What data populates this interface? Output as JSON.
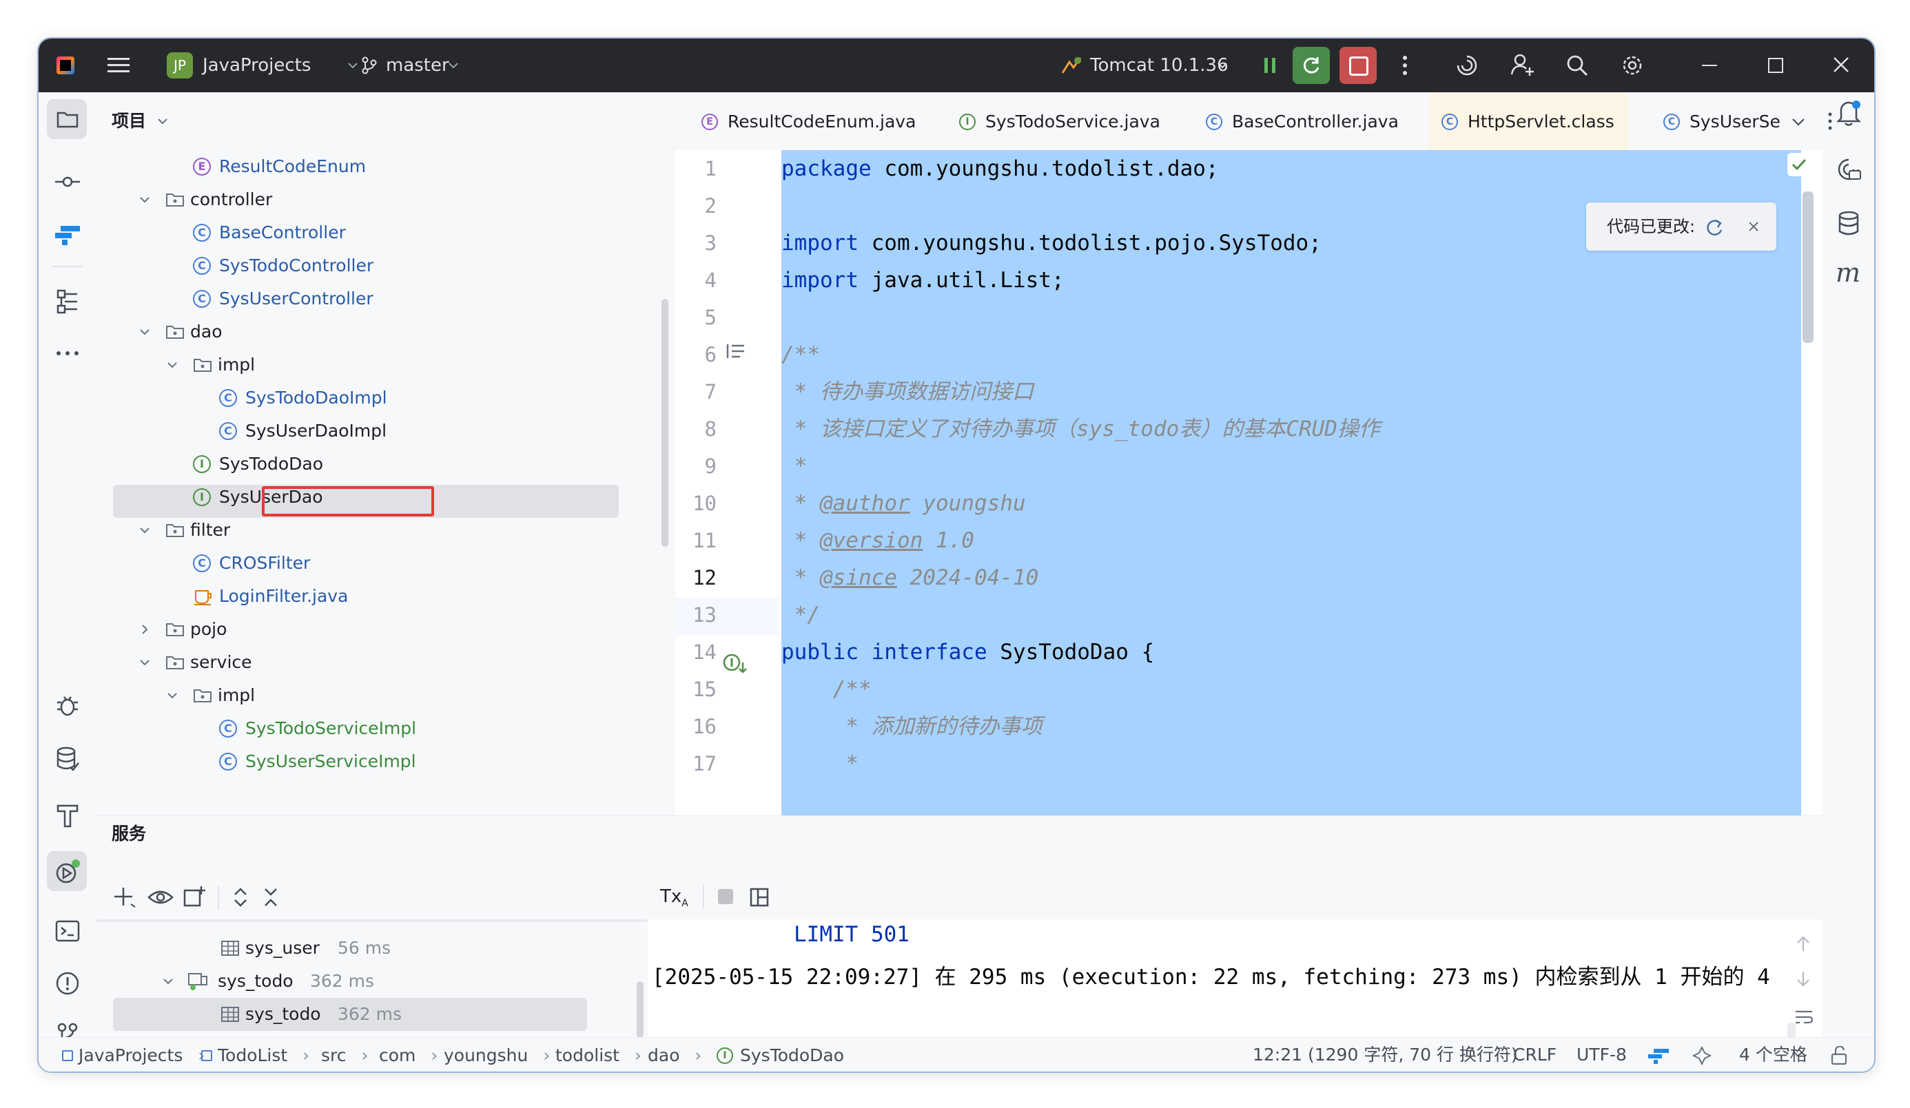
{
  "titlebar": {
    "project_badge": "JP",
    "project_name": "JavaProjects",
    "branch": "master",
    "run_config": "Tomcat 10.1.36"
  },
  "project_panel": {
    "title": "项目",
    "tree": [
      {
        "label": "ResultCodeEnum",
        "kind": "enum",
        "depth": 3
      },
      {
        "label": "controller",
        "kind": "folder",
        "depth": 2,
        "expanded": true
      },
      {
        "label": "BaseController",
        "kind": "class",
        "depth": 3
      },
      {
        "label": "SysTodoController",
        "kind": "class",
        "depth": 3
      },
      {
        "label": "SysUserController",
        "kind": "class",
        "depth": 3
      },
      {
        "label": "dao",
        "kind": "folder",
        "depth": 2,
        "expanded": true
      },
      {
        "label": "impl",
        "kind": "folder",
        "depth": 3,
        "expanded": true
      },
      {
        "label": "SysTodoDaoImpl",
        "kind": "class",
        "depth": 4
      },
      {
        "label": "SysUserDaoImpl",
        "kind": "class",
        "depth": 4
      },
      {
        "label": "SysTodoDao",
        "kind": "interface",
        "depth": 3,
        "selected": true
      },
      {
        "label": "SysUserDao",
        "kind": "interface",
        "depth": 3
      },
      {
        "label": "filter",
        "kind": "folder",
        "depth": 2,
        "expanded": true
      },
      {
        "label": "CROSFilter",
        "kind": "class",
        "depth": 3
      },
      {
        "label": "LoginFilter.java",
        "kind": "java",
        "depth": 3
      },
      {
        "label": "pojo",
        "kind": "folder",
        "depth": 2,
        "expanded": false
      },
      {
        "label": "service",
        "kind": "folder",
        "depth": 2,
        "expanded": true
      },
      {
        "label": "impl",
        "kind": "folder",
        "depth": 3,
        "expanded": true
      },
      {
        "label": "SysTodoServiceImpl",
        "kind": "class",
        "depth": 4
      },
      {
        "label": "SysUserServiceImpl",
        "kind": "class",
        "depth": 4
      }
    ]
  },
  "editor": {
    "tabs": [
      {
        "label": "ResultCodeEnum.java",
        "icon": "enum"
      },
      {
        "label": "SysTodoService.java",
        "icon": "interface"
      },
      {
        "label": "BaseController.java",
        "icon": "class"
      },
      {
        "label": "HttpServlet.class",
        "icon": "class-lib",
        "active": true
      },
      {
        "label": "SysUserSe",
        "icon": "class"
      }
    ],
    "notification": "代码已更改:",
    "line_numbers": [
      "1",
      "2",
      "3",
      "4",
      "5",
      "6",
      "7",
      "8",
      "9",
      "10",
      "11",
      "12",
      "13",
      "14",
      "15",
      "16",
      "17"
    ],
    "code": {
      "l1_kw": "package",
      "l1_rest": " com.youngshu.todolist.dao;",
      "l3_kw": "import",
      "l3_rest": " com.youngshu.todolist.pojo.SysTodo;",
      "l4_kw": "import",
      "l4_rest": " java.util.List;",
      "l6": "/**",
      "l7": " * 待办事项数据访问接口",
      "l8": " * 该接口定义了对待办事项（sys_todo表）的基本CRUD操作",
      "l9": " *",
      "l10_star": " * ",
      "l10_tag": "@author",
      "l10_val": " youngshu",
      "l11_star": " * ",
      "l11_tag": "@version",
      "l11_val": " 1.0",
      "l12_star": " * ",
      "l12_tag": "@since",
      "l12_val": " 2024-04-10",
      "l13": " */",
      "l14_kw": "public interface",
      "l14_rest": " SysTodoDao {",
      "l15": "    /**",
      "l16": "     * 添加新的待办事项",
      "l17": "     *"
    }
  },
  "services": {
    "title": "服务",
    "tx_label": "Tx",
    "tree": [
      {
        "label": "sys_user",
        "time": "56 ms"
      },
      {
        "label": "sys_todo",
        "time": "362 ms"
      },
      {
        "label": "sys_todo",
        "time": "362 ms",
        "selected": true
      }
    ],
    "console_line1": "LIMIT 501",
    "console_line2": "[2025-05-15 22:09:27] 在 295 ms (execution: 22 ms, fetching: 273 ms) 内检索到从 1 开始的 4"
  },
  "statusbar": {
    "breadcrumb": [
      "JavaProjects",
      "TodoList",
      "src",
      "com",
      "youngshu",
      "todolist",
      "dao",
      "SysTodoDao"
    ],
    "position": "12:21 (1290 字符, 70 行 换行符)",
    "line_sep": "CRLF",
    "encoding": "UTF-8",
    "indent": "4 个空格"
  },
  "colors": {
    "titlebar_bg": "#27282c",
    "selection_bg": "#a6d2ff",
    "keyword": "#0033b3",
    "comment": "#8c8c8c",
    "class_name": "#2a5ba8",
    "interface_green": "#4e8f45",
    "highlight_red": "#e53935"
  }
}
